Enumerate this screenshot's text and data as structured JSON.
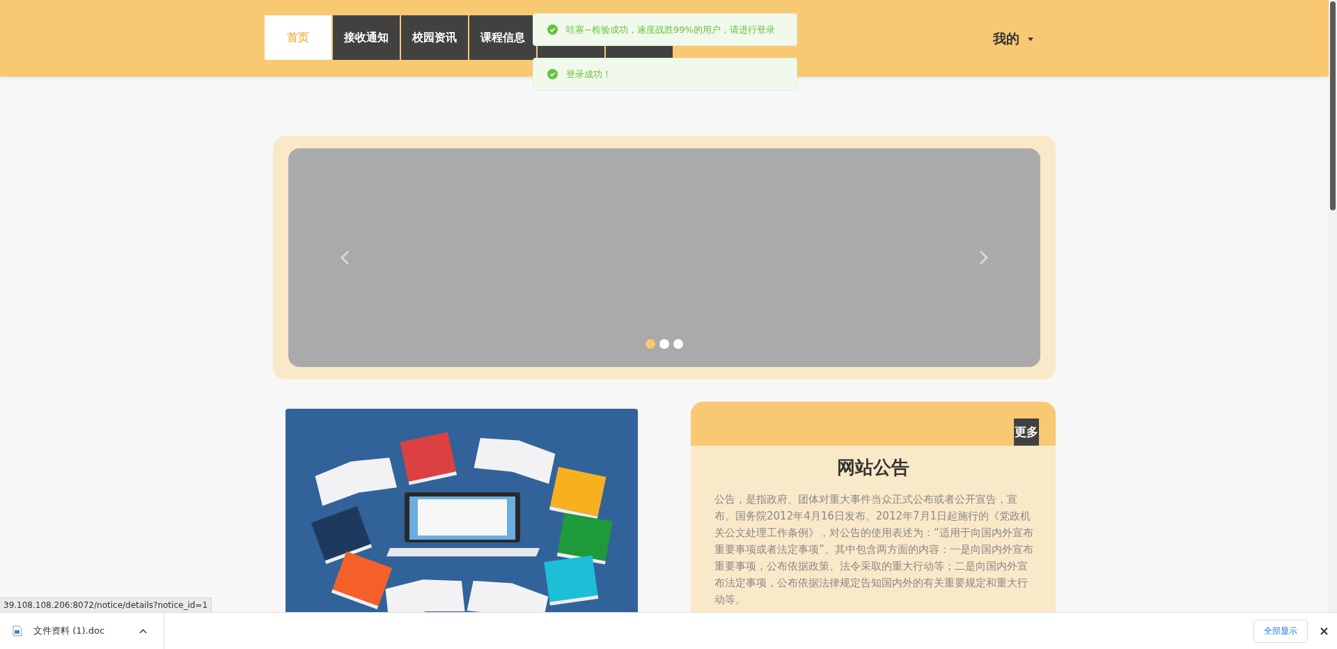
{
  "nav": {
    "tabs": [
      {
        "label": "首页",
        "selected": true
      },
      {
        "label": "接收通知",
        "selected": false
      },
      {
        "label": "校园资讯",
        "selected": false
      },
      {
        "label": "课程信息",
        "selected": false
      },
      {
        "selected": false
      },
      {
        "selected": false
      }
    ],
    "user_menu": {
      "label": "我的"
    }
  },
  "toasts": [
    {
      "message": "哇塞~检验成功，速度战胜99%的用户，请进行登录"
    },
    {
      "message": "登录成功！"
    }
  ],
  "carousel": {
    "indicators": [
      {
        "selected": true
      },
      {
        "selected": false
      },
      {
        "selected": false
      }
    ]
  },
  "notice": {
    "more_button": "更多",
    "title": "网站公告",
    "body": "公告，是指政府、团体对重大事件当众正式公布或者公开宣告，宣布。国务院2012年4月16日发布、2012年7月1日起施行的《党政机关公文处理工作条例》，对公告的使用表述为：“适用于向国内外宣布重要事项或者法定事项”。其中包含两方面的内容：一是向国内外宣布重要事项，公布依据政策、法令采取的重大行动等；二是向国内外宣布法定事项，公布依据法律规定告知国内外的有关重要规定和重大行动等。"
  },
  "status_url": "39.108.108.206:8072/notice/details?notice_id=1",
  "download_bar": {
    "file": "文件资料 (1).doc",
    "show_all": "全部显示"
  }
}
